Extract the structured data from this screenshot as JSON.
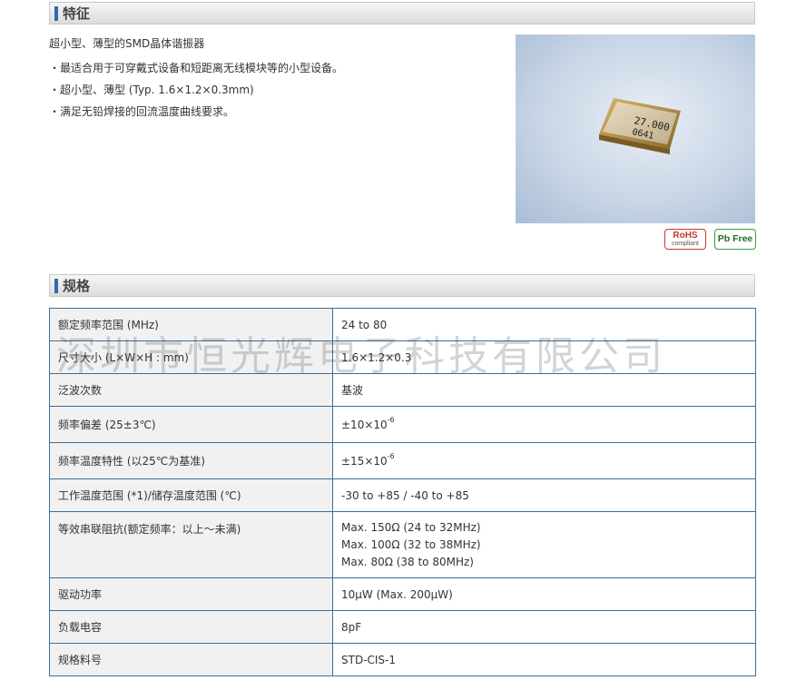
{
  "features": {
    "title": "特征",
    "intro": "超小型、薄型的SMD晶体谐振器",
    "bullets": [
      "・最适合用于可穿戴式设备和短距离无线模块等的小型设备。",
      "・超小型、薄型 (Typ. 1.6×1.2×0.3mm)",
      "・满足无铅焊接的回流温度曲线要求。"
    ],
    "product_marking": [
      "27.000",
      "0641"
    ],
    "badges": {
      "rohs": "RoHS",
      "rohs_sub": "compliant",
      "pbfree": "Pb Free"
    }
  },
  "specs": {
    "title": "规格",
    "rows": [
      {
        "label": "额定频率范围 (MHz)",
        "value": "24 to 80"
      },
      {
        "label": "尺寸大小 (L×W×H : mm)",
        "value": "1.6×1.2×0.3"
      },
      {
        "label": "泛波次数",
        "value": "基波"
      },
      {
        "label": "频率偏差 (25±3℃)",
        "value_base": "±10×10",
        "value_exp": "-6"
      },
      {
        "label": "频率温度特性 (以25℃为基准)",
        "value_base": "±15×10",
        "value_exp": "-6"
      },
      {
        "label": "工作温度范围 (*1)/储存温度范围 (℃)",
        "value": "-30 to +85 / -40 to +85"
      },
      {
        "label": "等效串联阻抗(额定频率：以上～未满)",
        "value_lines": [
          "Max. 150Ω (24 to 32MHz)",
          "Max. 100Ω (32 to 38MHz)",
          "Max. 80Ω (38 to 80MHz)"
        ]
      },
      {
        "label": "驱动功率",
        "value": "10μW (Max. 200μW)"
      },
      {
        "label": "负载电容",
        "value": "8pF"
      },
      {
        "label": "规格料号",
        "value": "STD-CIS-1"
      }
    ]
  },
  "watermark": "深圳市恒光辉电子科技有限公司",
  "colors": {
    "accent": "#2b6cb0",
    "table_border": "#3b6e99",
    "rohs": "#c0392b",
    "pbfree": "#3a9a3a"
  }
}
